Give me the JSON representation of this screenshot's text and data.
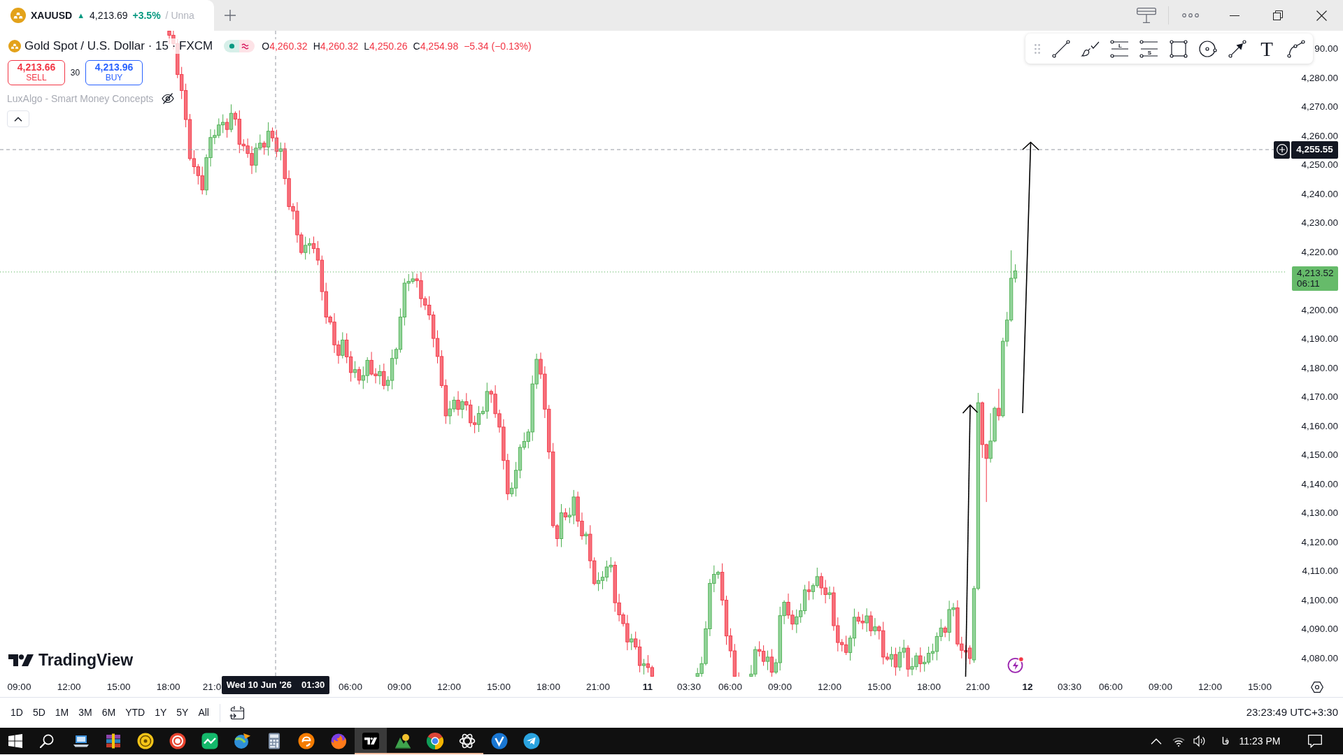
{
  "tabs": [
    {
      "symbol": "XAUUSD",
      "arrow": "▲",
      "price": "4,213.69",
      "change": "+3.5%",
      "rising": true,
      "layout": "/ Unna",
      "selected": true
    }
  ],
  "legend": {
    "title": "Gold Spot / U.S. Dollar · 15 · FXCM",
    "rising": false,
    "ohlc": [
      {
        "label": "O",
        "value": "4,260.32"
      },
      {
        "label": "H",
        "value": "4,260.32"
      },
      {
        "label": "L",
        "value": "4,250.26"
      },
      {
        "label": "C",
        "value": "4,254.98"
      }
    ],
    "change": "−5.34 (−0.13%)"
  },
  "trade": {
    "sell": {
      "price": "4,213.66",
      "label": "SELL"
    },
    "spread": "30",
    "buy": {
      "price": "4,213.96",
      "label": "BUY"
    }
  },
  "indicators": [
    {
      "name": "LuxAlgo - Smart Money Concepts",
      "hidden": true
    }
  ],
  "drawing_tools": [
    {
      "kind": "trend_line"
    },
    {
      "kind": "brush"
    },
    {
      "kind": "long",
      "glyph": "L"
    },
    {
      "kind": "short",
      "glyph": "S"
    },
    {
      "kind": "rectangle"
    },
    {
      "kind": "circle"
    },
    {
      "kind": "arrow"
    },
    {
      "kind": "text",
      "glyph": "T"
    },
    {
      "kind": "path"
    }
  ],
  "price_axis": {
    "items": [
      {
        "kind": "tick",
        "label": "90.00"
      },
      {
        "kind": "tick",
        "label": "4,280.00"
      },
      {
        "kind": "tick",
        "label": "4,270.00"
      },
      {
        "kind": "tick",
        "label": "4,260.00"
      },
      {
        "kind": "tick",
        "label": "4,250.00"
      },
      {
        "kind": "tick",
        "label": "4,240.00"
      },
      {
        "kind": "tick",
        "label": "4,230.00"
      },
      {
        "kind": "tick",
        "label": "4,220.00"
      },
      {
        "kind": "last_price",
        "price": "4,213.52",
        "countdown": "06:11"
      },
      {
        "kind": "tick",
        "label": "4,200.00"
      },
      {
        "kind": "tick",
        "label": "4,190.00"
      },
      {
        "kind": "tick",
        "label": "4,180.00"
      },
      {
        "kind": "tick",
        "label": "4,170.00"
      },
      {
        "kind": "tick",
        "label": "4,160.00"
      },
      {
        "kind": "tick",
        "label": "4,150.00"
      },
      {
        "kind": "tick",
        "label": "4,140.00"
      },
      {
        "kind": "tick",
        "label": "4,130.00"
      },
      {
        "kind": "tick",
        "label": "4,120.00"
      },
      {
        "kind": "tick",
        "label": "4,110.00"
      },
      {
        "kind": "tick",
        "label": "4,100.00"
      },
      {
        "kind": "tick",
        "label": "4,090.00"
      },
      {
        "kind": "tick",
        "label": "4,080.00"
      }
    ],
    "crosshair_price": "4,255.55"
  },
  "time_axis": {
    "labels": [
      {
        "kind": "time",
        "text": "09:00"
      },
      {
        "kind": "time",
        "text": "12:00"
      },
      {
        "kind": "time",
        "text": "15:00"
      },
      {
        "kind": "time",
        "text": "18:00"
      },
      {
        "kind": "time",
        "text": "21:0"
      },
      {
        "kind": "time",
        "text": "06:00"
      },
      {
        "kind": "time",
        "text": "09:00"
      },
      {
        "kind": "time",
        "text": "12:00"
      },
      {
        "kind": "time",
        "text": "15:00"
      },
      {
        "kind": "time",
        "text": "18:00"
      },
      {
        "kind": "time",
        "text": "21:00"
      },
      {
        "kind": "day",
        "text": "11"
      },
      {
        "kind": "time",
        "text": "03:30"
      },
      {
        "kind": "time",
        "text": "06:00"
      },
      {
        "kind": "time",
        "text": "09:00"
      },
      {
        "kind": "time",
        "text": "12:00"
      },
      {
        "kind": "time",
        "text": "15:00"
      },
      {
        "kind": "time",
        "text": "18:00"
      },
      {
        "kind": "time",
        "text": "21:00"
      },
      {
        "kind": "day",
        "text": "12"
      },
      {
        "kind": "time",
        "text": "03:30"
      },
      {
        "kind": "time",
        "text": "06:00"
      },
      {
        "kind": "time",
        "text": "09:00"
      },
      {
        "kind": "time",
        "text": "12:00"
      },
      {
        "kind": "time",
        "text": "15:00"
      }
    ],
    "crosshair": {
      "date": "Wed 10 Jun '26",
      "time": "01:30"
    }
  },
  "branding": "TradingView",
  "ranges": [
    "1D",
    "5D",
    "1M",
    "3M",
    "6M",
    "YTD",
    "1Y",
    "5Y",
    "All"
  ],
  "clock": "23:23:49 UTC+3:30",
  "taskbar": {
    "apps": [
      {
        "kind": "start",
        "running": false,
        "selected": false
      },
      {
        "kind": "search",
        "running": false,
        "selected": false
      },
      {
        "kind": "laptop",
        "running": false,
        "selected": false
      },
      {
        "kind": "books",
        "running": false,
        "selected": false
      },
      {
        "kind": "coin",
        "running": false,
        "selected": false
      },
      {
        "kind": "record",
        "running": false,
        "selected": false
      },
      {
        "kind": "trend",
        "running": false,
        "selected": false
      },
      {
        "kind": "globe",
        "running": false,
        "selected": false
      },
      {
        "kind": "calculator",
        "running": false,
        "selected": false
      },
      {
        "kind": "swirl",
        "running": false,
        "selected": false
      },
      {
        "kind": "flame",
        "running": false,
        "selected": false
      },
      {
        "kind": "logo",
        "running": true,
        "selected": true
      },
      {
        "kind": "peaks",
        "running": true,
        "selected": false
      },
      {
        "kind": "wheel",
        "running": true,
        "selected": false
      },
      {
        "kind": "knot",
        "running": true,
        "selected": false
      },
      {
        "kind": "check",
        "running": false,
        "selected": false
      },
      {
        "kind": "plane",
        "running": false,
        "selected": false
      }
    ],
    "tray": {
      "language": "فا",
      "time": "11:23 PM"
    }
  }
}
